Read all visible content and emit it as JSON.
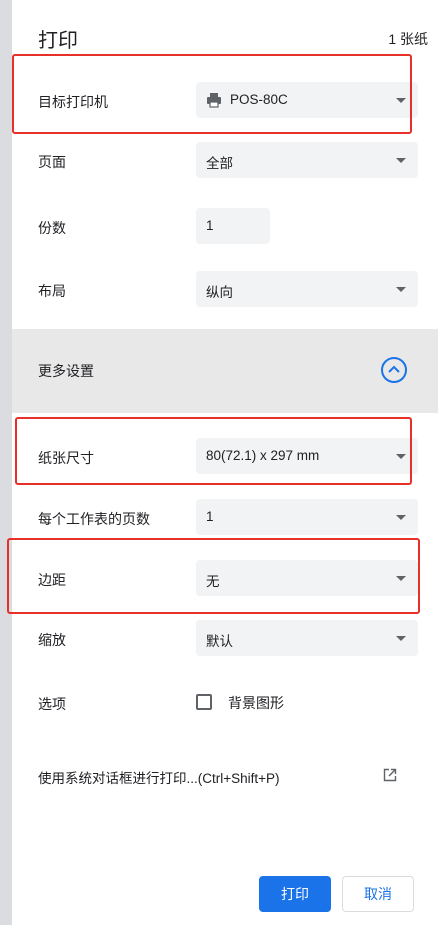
{
  "header": {
    "title": "打印",
    "sheet_count": "1 张纸"
  },
  "settings": {
    "destination": {
      "label": "目标打印机",
      "value": "POS-80C",
      "icon": "printer-icon"
    },
    "pages": {
      "label": "页面",
      "value": "全部"
    },
    "copies": {
      "label": "份数",
      "value": "1"
    },
    "layout": {
      "label": "布局",
      "value": "纵向"
    },
    "more_settings": {
      "label": "更多设置",
      "icon": "chevron-up-icon"
    },
    "paper_size": {
      "label": "纸张尺寸",
      "value": "80(72.1) x 297 mm"
    },
    "pages_per_sheet": {
      "label": "每个工作表的页数",
      "value": "1"
    },
    "margins": {
      "label": "边距",
      "value": "无"
    },
    "scale": {
      "label": "缩放",
      "value": "默认"
    },
    "options": {
      "label": "选项",
      "checkbox_label": "背景图形",
      "checked": false
    }
  },
  "system_dialog": {
    "label": "使用系统对话框进行打印...(Ctrl+Shift+P)",
    "icon": "open-external-icon"
  },
  "footer": {
    "print_label": "打印",
    "cancel_label": "取消"
  },
  "colors": {
    "accent": "#1a73e8",
    "highlight": "#e8302a",
    "field_bg": "#f1f3f4",
    "section_bg": "#e8e8e8"
  }
}
